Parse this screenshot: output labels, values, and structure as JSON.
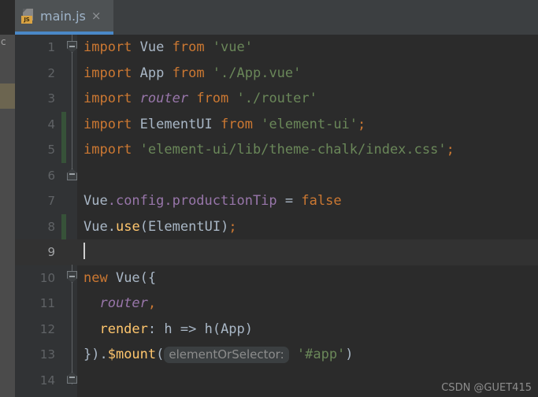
{
  "window": {
    "background_color": "#2B2B2B",
    "tabbar_color": "#3C3F41",
    "accent_color": "#4A88C7"
  },
  "tabbar": {
    "tab": {
      "title": "main.js",
      "icon": "javascript-file-icon",
      "icon_badge": "JS",
      "close_glyph": "×",
      "active": true
    }
  },
  "left_strip": {
    "glyph": "c"
  },
  "gutter": {
    "line_numbers": [
      "1",
      "2",
      "3",
      "4",
      "5",
      "6",
      "7",
      "8",
      "9",
      "10",
      "11",
      "12",
      "13",
      "14"
    ],
    "current_line": "9",
    "change_marker_lines": [
      "4",
      "5",
      "8"
    ],
    "fold_markers": [
      {
        "line": "1",
        "type": "collapse-down"
      },
      {
        "line": "5",
        "type": "collapse-up"
      },
      {
        "line": "10",
        "type": "collapse-down"
      },
      {
        "line": "13",
        "type": "collapse-up"
      }
    ]
  },
  "editor": {
    "language": "JavaScript",
    "colors": {
      "keyword": "#CC7832",
      "string": "#6A8759",
      "field": "#9876AA",
      "function": "#FFC66D",
      "default_text": "#A9B7C6",
      "current_line_bg": "#323232",
      "change_bar": "#375239"
    },
    "lines": {
      "l1": {
        "kw": "import",
        "cls": " Vue ",
        "kw2": "from",
        "str": " 'vue'"
      },
      "l2": {
        "kw": "import",
        "cls": " App ",
        "kw2": "from",
        "str": " './App.vue'"
      },
      "l3": {
        "kw": "import",
        "fld": " router ",
        "kw2": "from",
        "str": " './router'"
      },
      "l4": {
        "kw": "import",
        "cls": " ElementUI ",
        "kw2": "from",
        "str": " 'element-ui'",
        "semi": ";"
      },
      "l5": {
        "kw": "import",
        "str": " 'element-ui/lib/theme-chalk/index.css'",
        "semi": ";"
      },
      "l6": {
        "text": ""
      },
      "l7": {
        "cls": "Vue",
        "fld": ".config.productionTip",
        "op": " = ",
        "kw": "false"
      },
      "l8": {
        "cls": "Vue",
        "dot": ".",
        "fn": "use",
        "open": "(",
        "arg": "ElementUI",
        "close": ")",
        "semi": ";"
      },
      "l9": {
        "text": ""
      },
      "l10": {
        "kw": "new",
        "cls": " Vue",
        "pun": "({"
      },
      "l11": {
        "fld": "  router",
        "pun": ","
      },
      "l12": {
        "fn": "  render",
        "pun": ": ",
        "param": "h",
        "arrow": " => ",
        "call": "h(",
        "arg": "App",
        "close": ")"
      },
      "l13": {
        "pun": "}).",
        "fn": "$mount",
        "open": "(",
        "hint": "elementOrSelector:",
        "str": " '#app'",
        "close": ")"
      },
      "l14": {
        "text": ""
      }
    }
  },
  "watermark": {
    "text": "CSDN @GUET415"
  }
}
